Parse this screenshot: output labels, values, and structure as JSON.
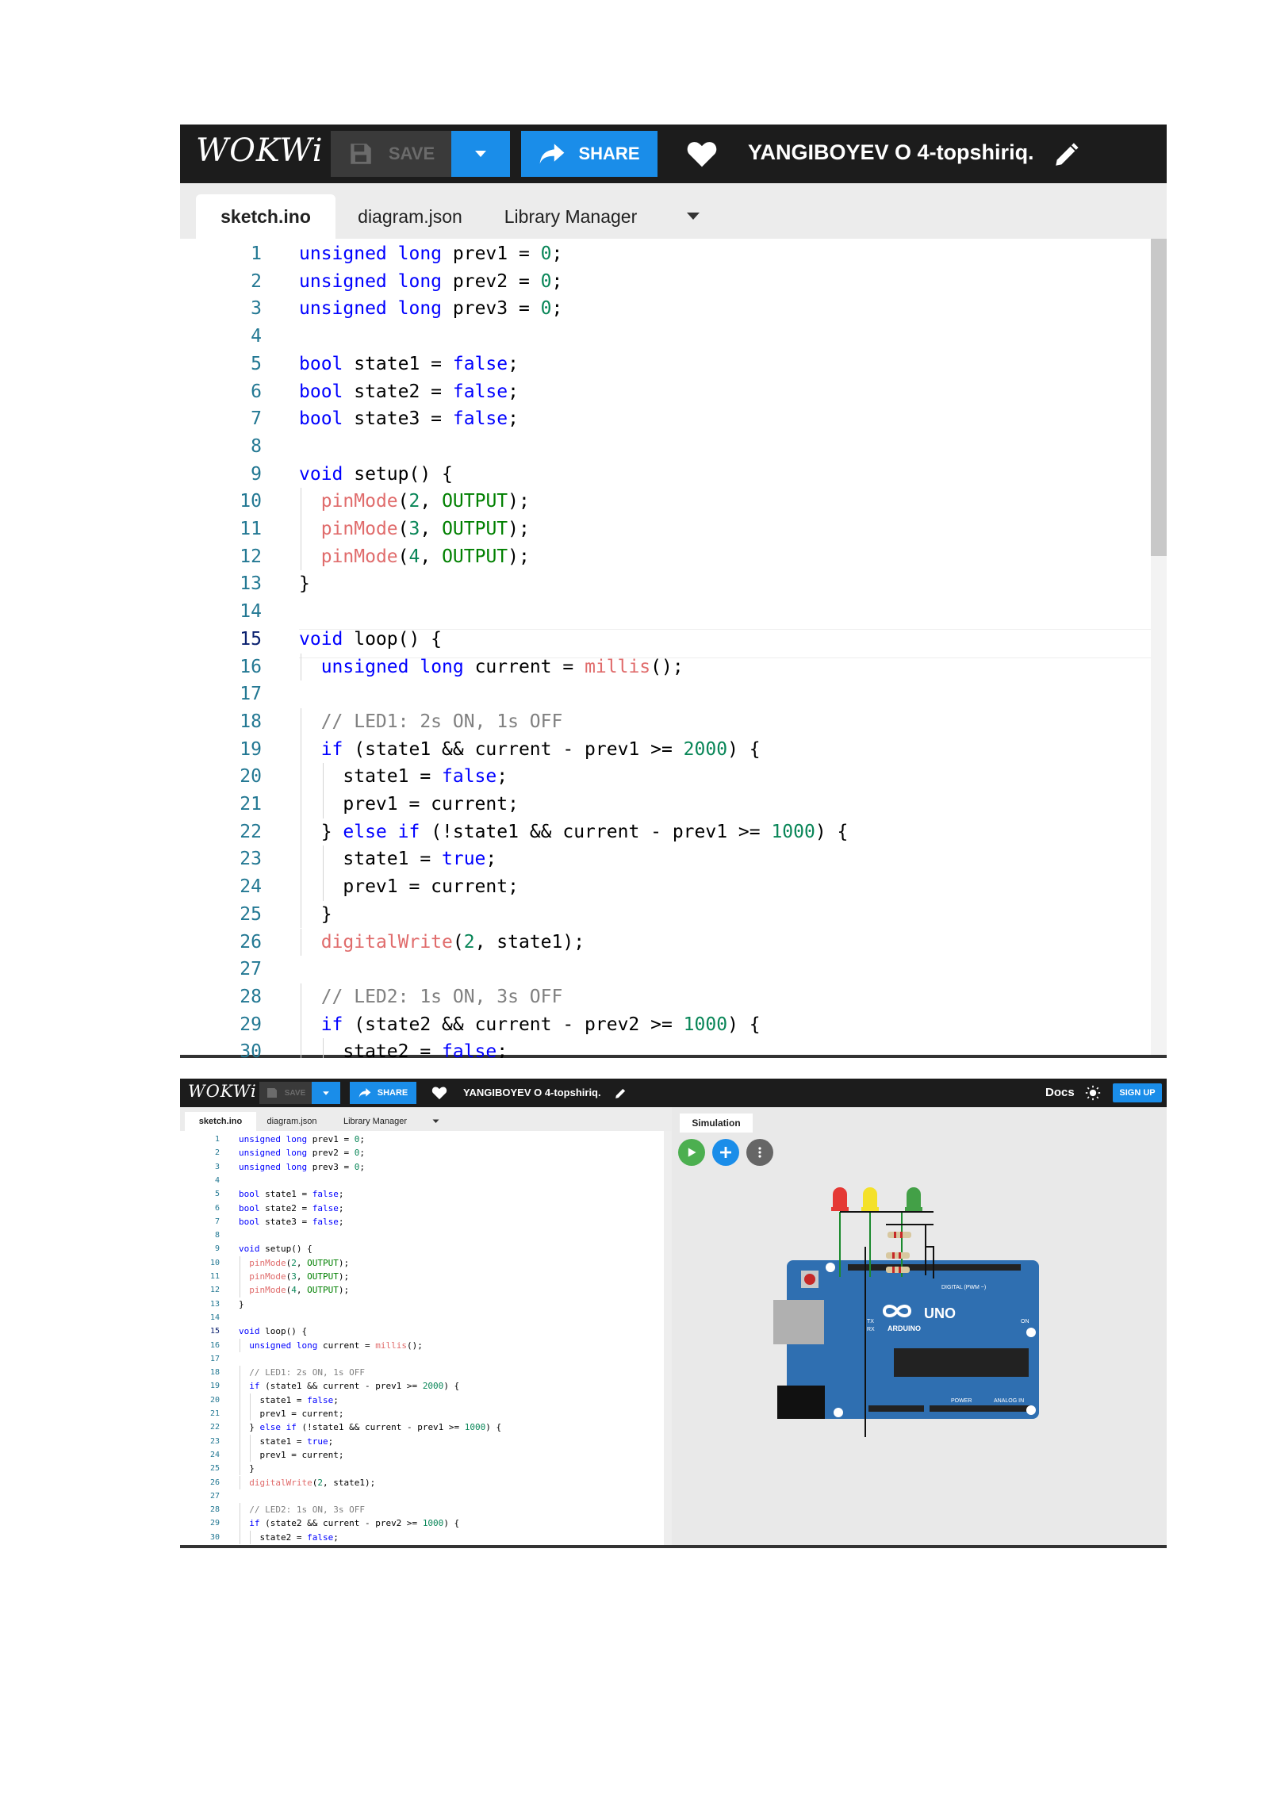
{
  "app": {
    "logo": "WOKWi",
    "save_label": "SAVE",
    "share_label": "SHARE",
    "project_title": "YANGIBOYEV O 4-topshiriq.",
    "docs_label": "Docs",
    "signup_label": "SIGN UP"
  },
  "tabs": [
    "sketch.ino",
    "diagram.json",
    "Library Manager"
  ],
  "simulation_tab": "Simulation",
  "code_lines_1": [
    "unsigned long prev1 = 0;",
    "unsigned long prev2 = 0;",
    "unsigned long prev3 = 0;",
    "",
    "bool state1 = false;",
    "bool state2 = false;",
    "bool state3 = false;",
    "",
    "void setup() {",
    "  pinMode(2, OUTPUT);",
    "  pinMode(3, OUTPUT);",
    "  pinMode(4, OUTPUT);",
    "}",
    "",
    "void loop() {",
    "  unsigned long current = millis();",
    "",
    "  // LED1: 2s ON, 1s OFF",
    "  if (state1 && current - prev1 >= 2000) {",
    "    state1 = false;",
    "    prev1 = current;",
    "  } else if (!state1 && current - prev1 >= 1000) {",
    "    state1 = true;",
    "    prev1 = current;",
    "  }",
    "  digitalWrite(2, state1);",
    "",
    "  // LED2: 1s ON, 3s OFF",
    "  if (state2 && current - prev2 >= 1000) {",
    "    state2 = false;"
  ],
  "code_lines_2": [
    "unsigned long prev1 = 0;",
    "unsigned long prev2 = 0;",
    "unsigned long prev3 = 0;",
    "",
    "bool state1 = false;",
    "bool state2 = false;",
    "bool state3 = false;",
    "",
    "void setup() {",
    "  pinMode(2, OUTPUT);",
    "  pinMode(3, OUTPUT);",
    "  pinMode(4, OUTPUT);",
    "}",
    "",
    "void loop() {",
    "  unsigned long current = millis();",
    "",
    "  // LED1: 2s ON, 1s OFF",
    "  if (state1 && current - prev1 >= 2000) {",
    "    state1 = false;",
    "    prev1 = current;",
    "  } else if (!state1 && current - prev1 >= 1000) {",
    "    state1 = true;",
    "    prev1 = current;",
    "  }",
    "  digitalWrite(2, state1);",
    "",
    "  // LED2: 1s ON, 3s OFF",
    "  if (state2 && current - prev2 >= 1000) {",
    "    state2 = false;"
  ],
  "board": {
    "brand": "ARDUINO",
    "model": "UNO",
    "digital_label": "DIGITAL (PWM ~)",
    "power_label": "POWER",
    "analog_label": "ANALOG IN",
    "on_label": "ON",
    "tx_label": "TX",
    "rx_label": "RX"
  },
  "leds": [
    {
      "color": "#e53935"
    },
    {
      "color": "#f4e12a"
    },
    {
      "color": "#43a047"
    }
  ],
  "colors": {
    "topbar": "#1c1c1c",
    "accent": "#1a8de9",
    "board": "#2f6fb1",
    "play": "#4caf50",
    "add": "#1a8de9"
  }
}
